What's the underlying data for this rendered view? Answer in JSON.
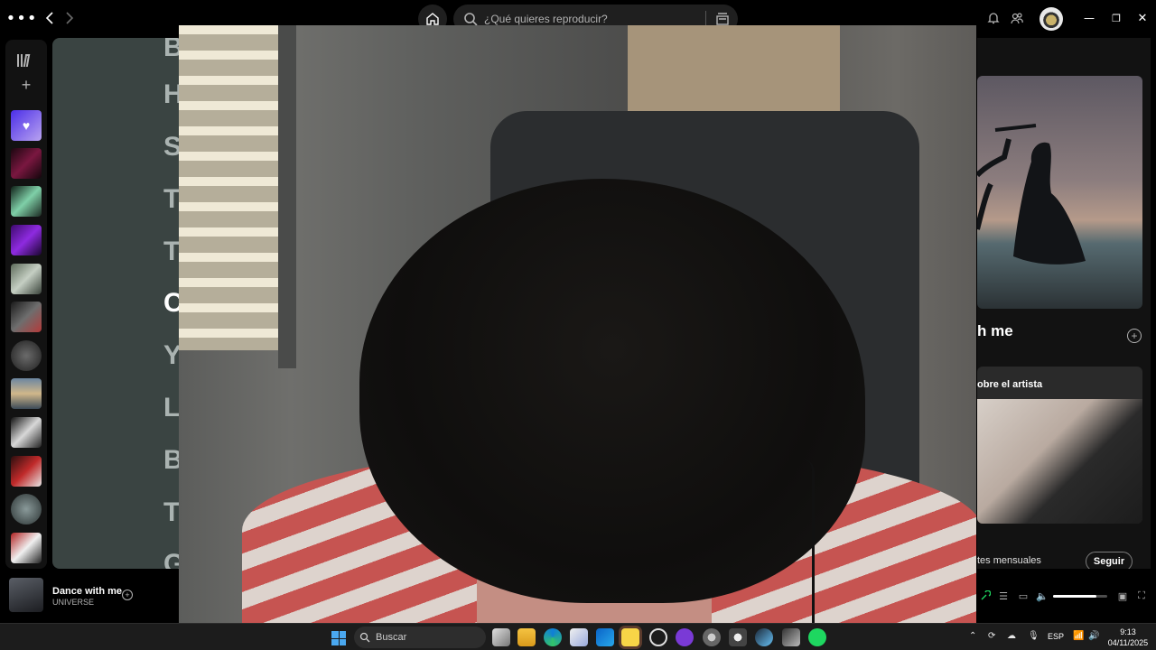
{
  "search": {
    "placeholder": "¿Qué quieres reproducir?"
  },
  "lyrics": {
    "lines": [
      "B",
      "H",
      "S",
      "T",
      "T",
      "C",
      "Y",
      "L",
      "B",
      "T",
      "G"
    ],
    "active_index": 5
  },
  "now_playing_view": {
    "title": "h me",
    "about_artist": "obre el artista",
    "listeners": "tes mensuales",
    "follow_label": "Seguir"
  },
  "player": {
    "track_title": "Dance with me",
    "artist": "UNIVERSE",
    "volume": 0.8
  },
  "taskbar": {
    "search_label": "Buscar",
    "language": "ESP",
    "time": "9:13",
    "date": "04/11/2025"
  },
  "colors": {
    "spotify_green": "#1ed760",
    "lyrics_background": "#3a4442",
    "taskbar": "#1c1c1c"
  }
}
